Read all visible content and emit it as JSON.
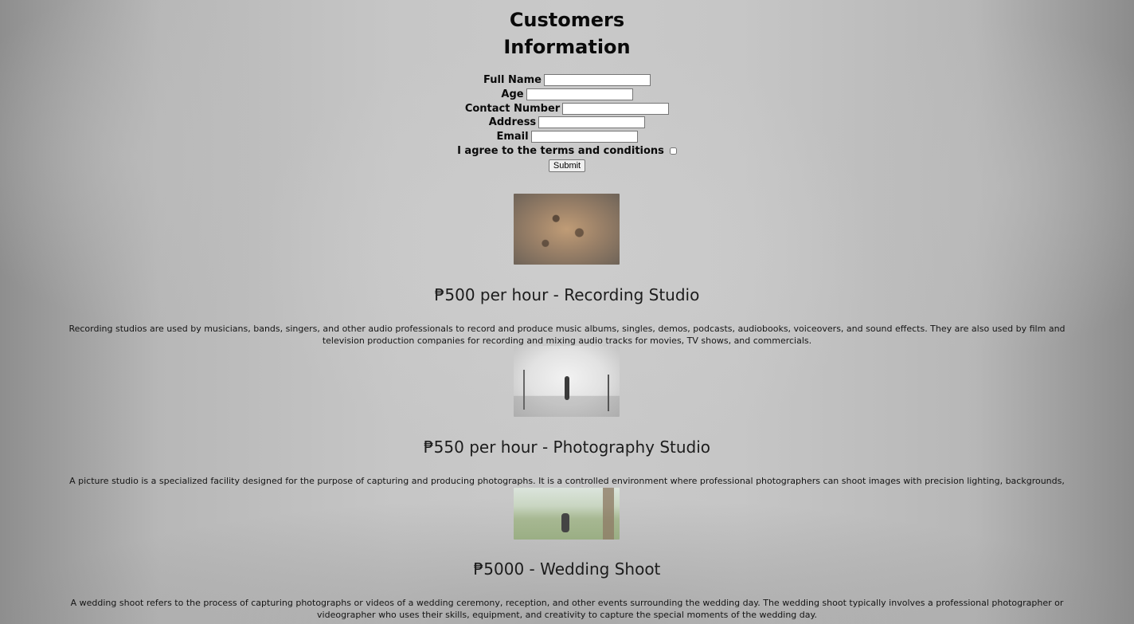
{
  "form": {
    "title_line1": "Customers",
    "title_line2": "Information",
    "fields": {
      "full_name_label": "Full Name",
      "full_name_value": "",
      "age_label": "Age",
      "age_value": "",
      "contact_label": "Contact Number",
      "contact_value": "",
      "address_label": "Address",
      "address_value": "",
      "email_label": "Email",
      "email_value": ""
    },
    "terms_label": "I agree to the terms and conditions",
    "terms_checked": false,
    "submit_label": "Submit"
  },
  "services": [
    {
      "title": "₱500 per hour - Recording Studio",
      "description": "Recording studios are used by musicians, bands, singers, and other audio professionals to record and produce music albums, singles, demos, podcasts, audiobooks, voiceovers, and sound effects. They are also used by film and television production companies for recording and mixing audio tracks for movies, TV shows, and commercials."
    },
    {
      "title": "₱550 per hour - Photography Studio",
      "description": "A picture studio is a specialized facility designed for the purpose of capturing and producing photographs. It is a controlled environment where professional photographers can shoot images with precision lighting, backgrounds, and props."
    },
    {
      "title": "₱5000 - Wedding Shoot",
      "description": "A wedding shoot refers to the process of capturing photographs or videos of a wedding ceremony, reception, and other events surrounding the wedding day. The wedding shoot typically involves a professional photographer or videographer who uses their skills, equipment, and creativity to capture the special moments of the wedding day."
    }
  ]
}
